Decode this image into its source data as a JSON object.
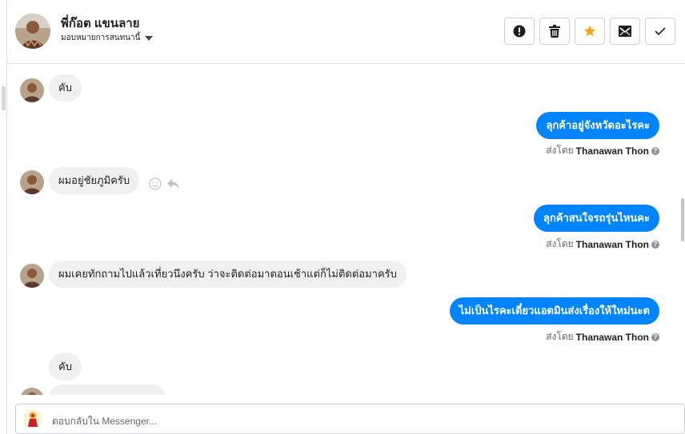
{
  "header": {
    "name": "พี่ก๊อต แขนลาย",
    "assign_label": "มอบหมายการสนทนานี้"
  },
  "actions": {
    "spam": "exclamation-icon",
    "delete": "trash-icon",
    "star": "star-icon",
    "unread": "envelope-icon",
    "done": "checkmark-icon"
  },
  "messages": [
    {
      "dir": "in",
      "text": "คับ"
    },
    {
      "dir": "out",
      "text": "ลุกค้าอยู่จังหวัดอะไรคะ",
      "sent_prefix": "ส่งโดย",
      "sender": "Thanawan Thon"
    },
    {
      "dir": "in",
      "text": "ผมอยู่ชัยภูมิครับ"
    },
    {
      "dir": "out",
      "text": "ลุกค้าสนใจรถรุ่นไหนคะ",
      "sent_prefix": "ส่งโดย",
      "sender": "Thanawan Thon"
    },
    {
      "dir": "in",
      "text": "ผมเคยทักถามไปแล้วเที่ยวนึงครับ ว่าจะติดต่อมาตอนเช้าแต่ก็ไม่ติดต่อมาครับ"
    },
    {
      "dir": "out",
      "text": "ไม่เป็นไรคะเดี๋ยวแอดมินส่งเรื่องให้ใหม่นะต",
      "sent_prefix": "ส่งโดย",
      "sender": "Thanawan Thon"
    },
    {
      "dir": "in",
      "text": "คับ"
    }
  ],
  "composer": {
    "placeholder": "ตอบกลับใน Messenger..."
  },
  "colors": {
    "accent": "#0084ff",
    "star": "#f5a623",
    "incoming_bubble": "#f1f0f0"
  }
}
